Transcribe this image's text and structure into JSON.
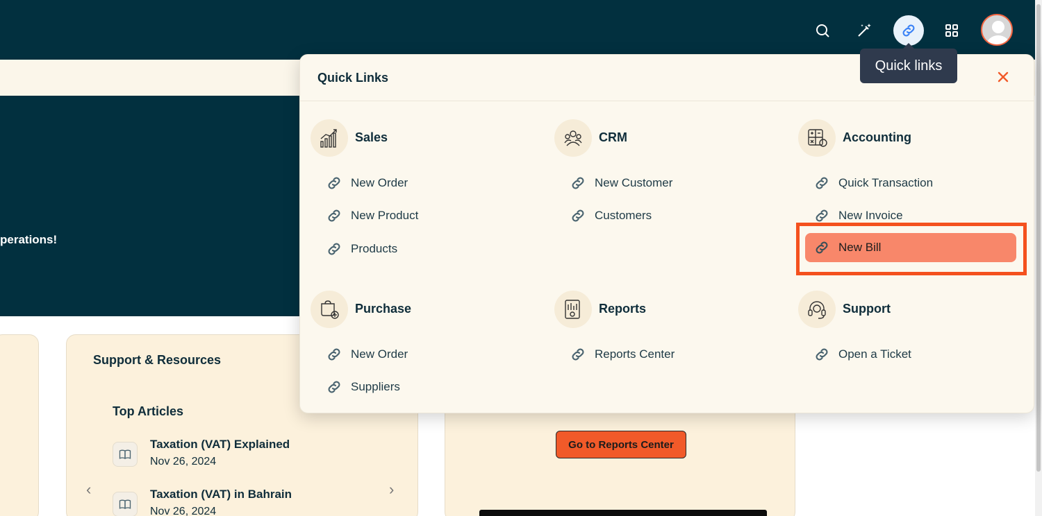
{
  "hero": {
    "text": "perations!"
  },
  "quick_links": {
    "title": "Quick Links",
    "tooltip": "Quick links",
    "groups": [
      {
        "label": "Sales",
        "icon": "sales-chart-icon",
        "links": [
          "New Order",
          "New Product",
          "Products"
        ]
      },
      {
        "label": "CRM",
        "icon": "crm-people-icon",
        "links": [
          "New Customer",
          "Customers"
        ]
      },
      {
        "label": "Accounting",
        "icon": "accounting-calculator-icon",
        "links": [
          "Quick Transaction",
          "New Invoice",
          "New Bill"
        ]
      },
      {
        "label": "Purchase",
        "icon": "purchase-bag-icon",
        "links": [
          "New Order",
          "Suppliers"
        ]
      },
      {
        "label": "Reports",
        "icon": "reports-document-icon",
        "links": [
          "Reports Center"
        ]
      },
      {
        "label": "Support",
        "icon": "support-headset-icon",
        "links": [
          "Open a Ticket"
        ]
      }
    ],
    "highlighted_link": "New Bill"
  },
  "support": {
    "title": "Support & Resources",
    "subtitle": "Top Articles",
    "articles": [
      {
        "title": "Taxation (VAT) Explained",
        "date": "Nov 26, 2024"
      },
      {
        "title": "Taxation (VAT) in Bahrain",
        "date": "Nov 26, 2024"
      }
    ]
  },
  "reports_card": {
    "button": "Go to Reports Center"
  },
  "colors": {
    "navy": "#02303f",
    "accent": "#f15a29",
    "highlight": "#f8876a",
    "panel_bg": "#fcf8ee"
  }
}
